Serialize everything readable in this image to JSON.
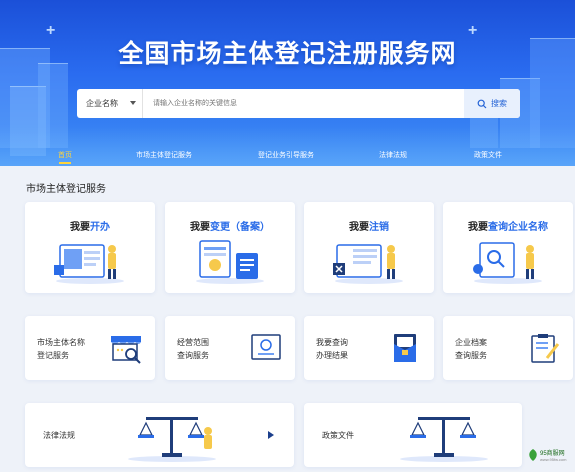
{
  "hero": {
    "title": "全国市场主体登记注册服务网"
  },
  "search": {
    "select_value": "企业名称",
    "placeholder": "请输入企业名称的关键信息",
    "button_label": "搜索"
  },
  "nav": {
    "items": [
      {
        "label": "首页",
        "active": true
      },
      {
        "label": "市场主体登记服务",
        "active": false
      },
      {
        "label": "登记业务引导服务",
        "active": false
      },
      {
        "label": "法律法规",
        "active": false
      },
      {
        "label": "政策文件",
        "active": false
      }
    ],
    "active_color": "#ffd43b"
  },
  "section": {
    "title": "市场主体登记服务"
  },
  "main_cards": [
    {
      "prefix": "我要",
      "highlight": "开办",
      "suffix": ""
    },
    {
      "prefix": "我要",
      "highlight": "变更（备案）",
      "suffix": ""
    },
    {
      "prefix": "我要",
      "highlight": "注销",
      "suffix": ""
    },
    {
      "prefix": "我要",
      "highlight": "查询企业名称",
      "suffix": ""
    }
  ],
  "service_cards": [
    {
      "line1": "市场主体名称",
      "line2": "登记服务",
      "icon": "shop-search-icon"
    },
    {
      "line1": "经营范围",
      "line2": "查询服务",
      "icon": "certificate-icon"
    },
    {
      "line1": "我要查询",
      "line2": "办理结果",
      "icon": "folder-document-icon"
    },
    {
      "line1": "企业档案",
      "line2": "查询服务",
      "icon": "clipboard-edit-icon"
    }
  ],
  "link_cards": [
    {
      "label": "法律法规",
      "icon": "scales-icon"
    },
    {
      "label": "政策文件",
      "icon": "scales-icon"
    }
  ],
  "watermark": {
    "line1": "95商服网",
    "line2": "www.95fw.com"
  },
  "colors": {
    "accent": "#2a6ce8",
    "hero_top": "#1b50d8",
    "hero_bottom": "#3f8ff5",
    "background": "#eef2f9"
  }
}
